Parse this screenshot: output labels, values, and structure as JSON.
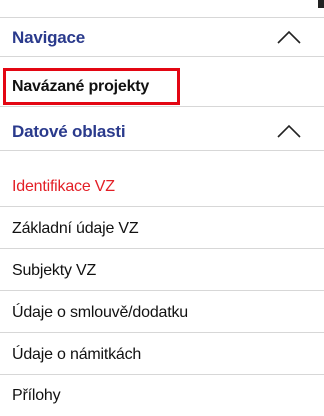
{
  "nav": {
    "section_label": "Navigace",
    "items": [
      {
        "label": "Navázané projekty"
      }
    ]
  },
  "data_areas": {
    "section_label": "Datové oblasti",
    "items": [
      {
        "label": "Identifikace VZ",
        "active": true
      },
      {
        "label": "Základní údaje VZ"
      },
      {
        "label": "Subjekty VZ"
      },
      {
        "label": "Údaje o smlouvě/dodatku"
      },
      {
        "label": "Údaje o námitkách"
      },
      {
        "label": "Přílohy"
      }
    ]
  },
  "icons": {
    "section_toggle": "chevron-up-icon"
  },
  "colors": {
    "section_header_text": "#2a3a8c",
    "active_item_text": "#e31f26",
    "highlight_border": "#e30613",
    "divider": "#d7d7d7"
  }
}
